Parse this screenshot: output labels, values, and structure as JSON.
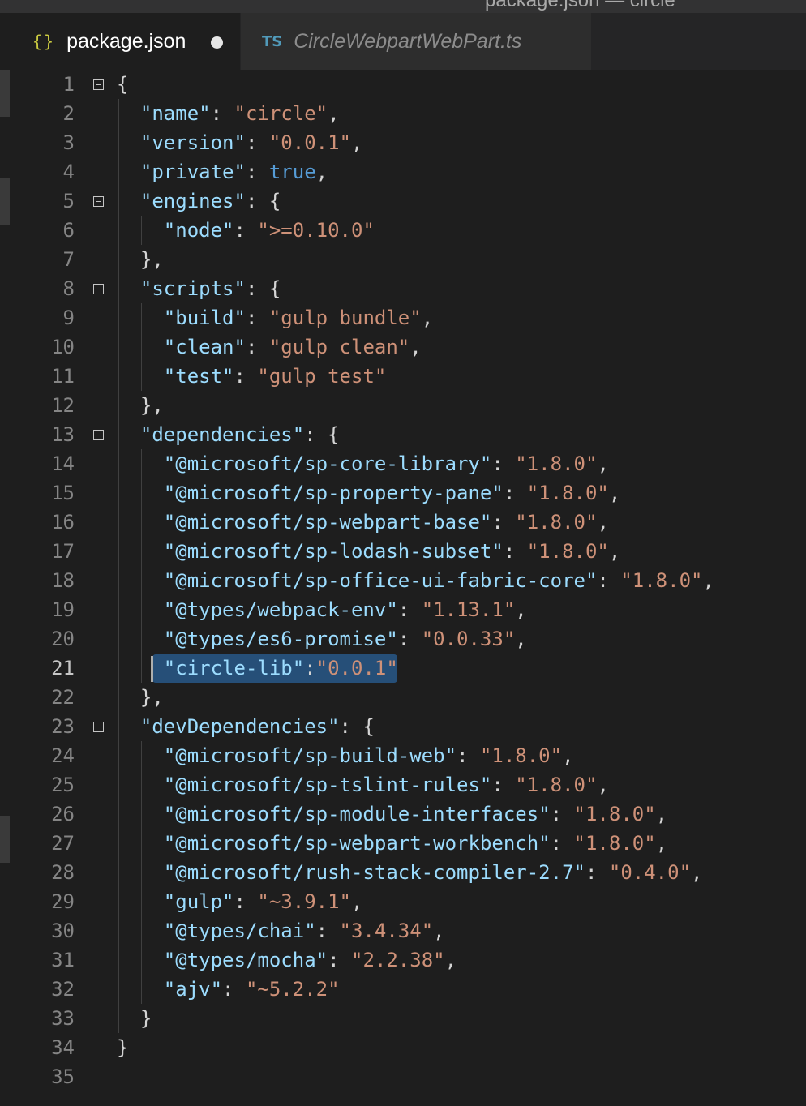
{
  "window": {
    "title": "package.json — circle"
  },
  "tabs": [
    {
      "icon": "{}",
      "label": "package.json",
      "active": true,
      "modified": true
    },
    {
      "icon": "TS",
      "label": "CircleWebpartWebPart.ts",
      "active": false,
      "modified": false
    }
  ],
  "editor": {
    "active_line": 21,
    "fold_lines": [
      1,
      5,
      8,
      13,
      23
    ],
    "lines": [
      [
        [
          "p",
          "{"
        ]
      ],
      [
        [
          "p",
          "  "
        ],
        [
          "k",
          "\"name\""
        ],
        [
          "p",
          ": "
        ],
        [
          "s",
          "\"circle\""
        ],
        [
          "p",
          ","
        ]
      ],
      [
        [
          "p",
          "  "
        ],
        [
          "k",
          "\"version\""
        ],
        [
          "p",
          ": "
        ],
        [
          "s",
          "\"0.0.1\""
        ],
        [
          "p",
          ","
        ]
      ],
      [
        [
          "p",
          "  "
        ],
        [
          "k",
          "\"private\""
        ],
        [
          "p",
          ": "
        ],
        [
          "b",
          "true"
        ],
        [
          "p",
          ","
        ]
      ],
      [
        [
          "p",
          "  "
        ],
        [
          "k",
          "\"engines\""
        ],
        [
          "p",
          ": {"
        ]
      ],
      [
        [
          "p",
          "    "
        ],
        [
          "k",
          "\"node\""
        ],
        [
          "p",
          ": "
        ],
        [
          "s",
          "\">=0.10.0\""
        ]
      ],
      [
        [
          "p",
          "  },"
        ]
      ],
      [
        [
          "p",
          "  "
        ],
        [
          "k",
          "\"scripts\""
        ],
        [
          "p",
          ": {"
        ]
      ],
      [
        [
          "p",
          "    "
        ],
        [
          "k",
          "\"build\""
        ],
        [
          "p",
          ": "
        ],
        [
          "s",
          "\"gulp bundle\""
        ],
        [
          "p",
          ","
        ]
      ],
      [
        [
          "p",
          "    "
        ],
        [
          "k",
          "\"clean\""
        ],
        [
          "p",
          ": "
        ],
        [
          "s",
          "\"gulp clean\""
        ],
        [
          "p",
          ","
        ]
      ],
      [
        [
          "p",
          "    "
        ],
        [
          "k",
          "\"test\""
        ],
        [
          "p",
          ": "
        ],
        [
          "s",
          "\"gulp test\""
        ]
      ],
      [
        [
          "p",
          "  },"
        ]
      ],
      [
        [
          "p",
          "  "
        ],
        [
          "k",
          "\"dependencies\""
        ],
        [
          "p",
          ": {"
        ]
      ],
      [
        [
          "p",
          "    "
        ],
        [
          "k",
          "\"@microsoft/sp-core-library\""
        ],
        [
          "p",
          ": "
        ],
        [
          "s",
          "\"1.8.0\""
        ],
        [
          "p",
          ","
        ]
      ],
      [
        [
          "p",
          "    "
        ],
        [
          "k",
          "\"@microsoft/sp-property-pane\""
        ],
        [
          "p",
          ": "
        ],
        [
          "s",
          "\"1.8.0\""
        ],
        [
          "p",
          ","
        ]
      ],
      [
        [
          "p",
          "    "
        ],
        [
          "k",
          "\"@microsoft/sp-webpart-base\""
        ],
        [
          "p",
          ": "
        ],
        [
          "s",
          "\"1.8.0\""
        ],
        [
          "p",
          ","
        ]
      ],
      [
        [
          "p",
          "    "
        ],
        [
          "k",
          "\"@microsoft/sp-lodash-subset\""
        ],
        [
          "p",
          ": "
        ],
        [
          "s",
          "\"1.8.0\""
        ],
        [
          "p",
          ","
        ]
      ],
      [
        [
          "p",
          "    "
        ],
        [
          "k",
          "\"@microsoft/sp-office-ui-fabric-core\""
        ],
        [
          "p",
          ": "
        ],
        [
          "s",
          "\"1.8.0\""
        ],
        [
          "p",
          ","
        ]
      ],
      [
        [
          "p",
          "    "
        ],
        [
          "k",
          "\"@types/webpack-env\""
        ],
        [
          "p",
          ": "
        ],
        [
          "s",
          "\"1.13.1\""
        ],
        [
          "p",
          ","
        ]
      ],
      [
        [
          "p",
          "    "
        ],
        [
          "k",
          "\"@types/es6-promise\""
        ],
        [
          "p",
          ": "
        ],
        [
          "s",
          "\"0.0.33\""
        ],
        [
          "p",
          ","
        ]
      ],
      [
        [
          "p",
          "    "
        ],
        [
          "k",
          "\"circle-lib\""
        ],
        [
          "p",
          ":"
        ],
        [
          "s",
          "\"0.0.1\""
        ]
      ],
      [
        [
          "p",
          "  },"
        ]
      ],
      [
        [
          "p",
          "  "
        ],
        [
          "k",
          "\"devDependencies\""
        ],
        [
          "p",
          ": {"
        ]
      ],
      [
        [
          "p",
          "    "
        ],
        [
          "k",
          "\"@microsoft/sp-build-web\""
        ],
        [
          "p",
          ": "
        ],
        [
          "s",
          "\"1.8.0\""
        ],
        [
          "p",
          ","
        ]
      ],
      [
        [
          "p",
          "    "
        ],
        [
          "k",
          "\"@microsoft/sp-tslint-rules\""
        ],
        [
          "p",
          ": "
        ],
        [
          "s",
          "\"1.8.0\""
        ],
        [
          "p",
          ","
        ]
      ],
      [
        [
          "p",
          "    "
        ],
        [
          "k",
          "\"@microsoft/sp-module-interfaces\""
        ],
        [
          "p",
          ": "
        ],
        [
          "s",
          "\"1.8.0\""
        ],
        [
          "p",
          ","
        ]
      ],
      [
        [
          "p",
          "    "
        ],
        [
          "k",
          "\"@microsoft/sp-webpart-workbench\""
        ],
        [
          "p",
          ": "
        ],
        [
          "s",
          "\"1.8.0\""
        ],
        [
          "p",
          ","
        ]
      ],
      [
        [
          "p",
          "    "
        ],
        [
          "k",
          "\"@microsoft/rush-stack-compiler-2.7\""
        ],
        [
          "p",
          ": "
        ],
        [
          "s",
          "\"0.4.0\""
        ],
        [
          "p",
          ","
        ]
      ],
      [
        [
          "p",
          "    "
        ],
        [
          "k",
          "\"gulp\""
        ],
        [
          "p",
          ": "
        ],
        [
          "s",
          "\"~3.9.1\""
        ],
        [
          "p",
          ","
        ]
      ],
      [
        [
          "p",
          "    "
        ],
        [
          "k",
          "\"@types/chai\""
        ],
        [
          "p",
          ": "
        ],
        [
          "s",
          "\"3.4.34\""
        ],
        [
          "p",
          ","
        ]
      ],
      [
        [
          "p",
          "    "
        ],
        [
          "k",
          "\"@types/mocha\""
        ],
        [
          "p",
          ": "
        ],
        [
          "s",
          "\"2.2.38\""
        ],
        [
          "p",
          ","
        ]
      ],
      [
        [
          "p",
          "    "
        ],
        [
          "k",
          "\"ajv\""
        ],
        [
          "p",
          ": "
        ],
        [
          "s",
          "\"~5.2.2\""
        ]
      ],
      [
        [
          "p",
          "  }"
        ]
      ],
      [
        [
          "p",
          "}"
        ]
      ],
      []
    ]
  },
  "colors": {
    "editor_bg": "#1e1e1e",
    "key": "#9cdcfe",
    "string": "#ce9178",
    "boolean": "#569cd6",
    "punctuation": "#d4d4d4",
    "selection": "#264f78"
  }
}
